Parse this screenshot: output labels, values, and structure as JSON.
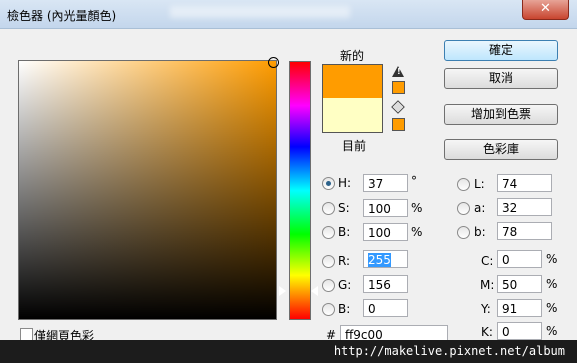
{
  "window": {
    "title": "檢色器 (內光量顏色)",
    "close_label": "✕"
  },
  "swatch": {
    "new_label": "新的",
    "current_label": "目前",
    "new_color": "#ff9c00",
    "current_color": "#ffffc4",
    "warning_icon": "warning-icon",
    "websafe_icon": "cube-icon"
  },
  "buttons": {
    "ok": "確定",
    "cancel": "取消",
    "add_to_swatches": "增加到色票",
    "color_libraries": "色彩庫"
  },
  "hsb": {
    "h": {
      "label": "H:",
      "value": "37",
      "unit": "°"
    },
    "s": {
      "label": "S:",
      "value": "100",
      "unit": "%"
    },
    "b": {
      "label": "B:",
      "value": "100",
      "unit": "%"
    }
  },
  "rgb": {
    "r": {
      "label": "R:",
      "value": "255"
    },
    "g": {
      "label": "G:",
      "value": "156"
    },
    "b": {
      "label": "B:",
      "value": "0"
    }
  },
  "lab": {
    "l": {
      "label": "L:",
      "value": "74"
    },
    "a": {
      "label": "a:",
      "value": "32"
    },
    "b": {
      "label": "b:",
      "value": "78"
    }
  },
  "cmyk": {
    "c": {
      "label": "C:",
      "value": "0",
      "unit": "%"
    },
    "m": {
      "label": "M:",
      "value": "50",
      "unit": "%"
    },
    "y": {
      "label": "Y:",
      "value": "91",
      "unit": "%"
    },
    "k": {
      "label": "K:",
      "value": "0",
      "unit": "%"
    }
  },
  "hex": {
    "label": "#",
    "value": "ff9c00"
  },
  "web_only": {
    "label": "僅網頁色彩",
    "checked": false
  },
  "watermark": "http://makelive.pixnet.net/album"
}
